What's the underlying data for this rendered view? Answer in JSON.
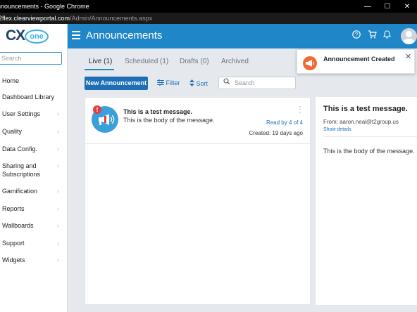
{
  "window": {
    "title": "nnouncements - Google Chrome",
    "controls": [
      "—",
      "☐",
      "✕"
    ],
    "url_host": "l2flex.clearviewportal.com",
    "url_path": "/Admin/Announcements.aspx"
  },
  "logo": {
    "cx": "CX",
    "one": "one"
  },
  "sidebar": {
    "search_placeholder": "Search",
    "items": [
      {
        "label": "Home",
        "chevron": false
      },
      {
        "label": "Dashboard Library",
        "chevron": false
      },
      {
        "label": "User Settings",
        "chevron": true
      },
      {
        "label": "Quality",
        "chevron": true
      },
      {
        "label": "Data Config.",
        "chevron": true
      },
      {
        "label": "Sharing and Subscriptions",
        "chevron": true
      },
      {
        "label": "Gamification",
        "chevron": true
      },
      {
        "label": "Reports",
        "chevron": true
      },
      {
        "label": "Wallboards",
        "chevron": true
      },
      {
        "label": "Support",
        "chevron": true
      },
      {
        "label": "Widgets",
        "chevron": true
      }
    ]
  },
  "header": {
    "title": "Announcements",
    "icons": [
      "help-icon",
      "cart-icon",
      "bell-icon",
      "avatar"
    ]
  },
  "tabs": [
    {
      "label": "Live (1)",
      "active": true
    },
    {
      "label": "Scheduled (1)",
      "active": false
    },
    {
      "label": "Drafts (0)",
      "active": false
    },
    {
      "label": "Archived",
      "active": false
    }
  ],
  "toolbar": {
    "new_label": "New Announcement",
    "filter_label": "Filter",
    "sort_label": "Sort",
    "search_placeholder": "Search"
  },
  "announcement": {
    "badge": "!",
    "title": "This is a test message.",
    "body": "This is the body of the message.",
    "read": "Read by 4 of 4",
    "created": "Created: 19 days ago"
  },
  "detail": {
    "title": "This is a test message.",
    "from": "From: aaron.neal@t2group.us",
    "show_details": "Show details",
    "body": "This is the body of the message."
  },
  "toast": {
    "text": "Announcement Created",
    "close": "✕"
  },
  "colors": {
    "accent": "#1f86c7",
    "primary_button": "#1f6fb6",
    "badge_red": "#e23d3d",
    "toast_orange": "#ef6a35"
  }
}
